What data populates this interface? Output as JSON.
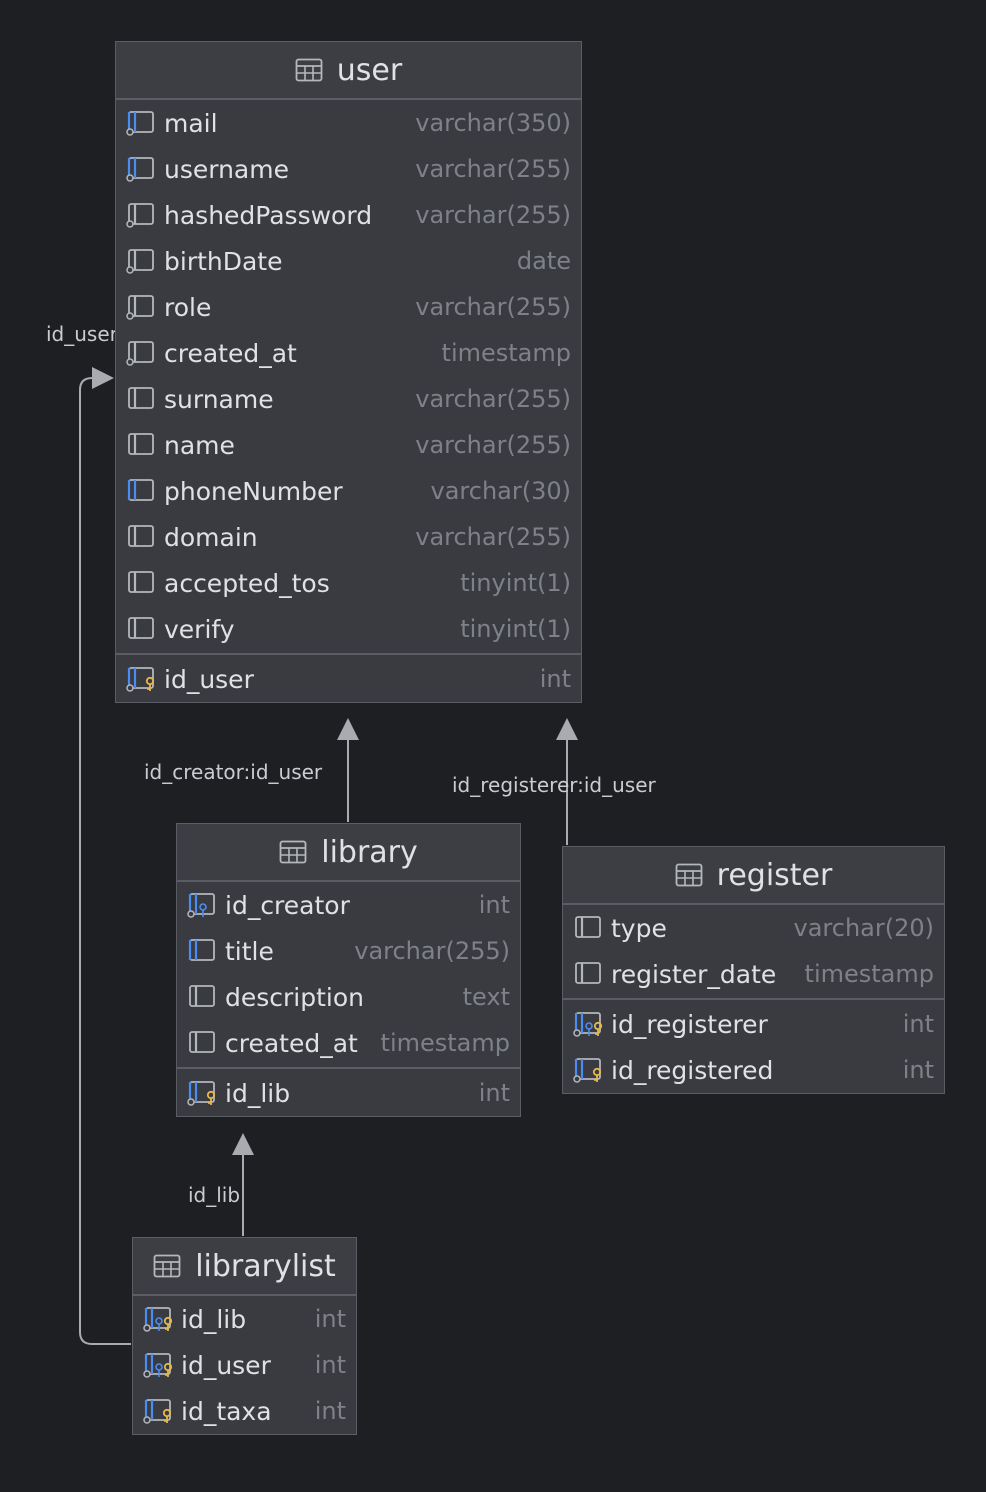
{
  "colors": {
    "background": "#1e1f22",
    "table_body": "#393b40",
    "table_header": "#3c3e43",
    "border": "#5a5d63",
    "text": "#dfe1e5",
    "type_text": "#7e8187",
    "edge": "#a9abb0",
    "fk_blue": "#4b8cf0",
    "pk_gold": "#e8b84a"
  },
  "tables": {
    "user": {
      "title": "user",
      "columns": [
        {
          "name": "mail",
          "type": "varchar(350)",
          "icon": "column-indexed-nullable-icon"
        },
        {
          "name": "username",
          "type": "varchar(255)",
          "icon": "column-indexed-nullable-icon"
        },
        {
          "name": "hashedPassword",
          "type": "varchar(255)",
          "icon": "column-nullable-icon"
        },
        {
          "name": "birthDate",
          "type": "date",
          "icon": "column-nullable-icon"
        },
        {
          "name": "role",
          "type": "varchar(255)",
          "icon": "column-nullable-icon"
        },
        {
          "name": "created_at",
          "type": "timestamp",
          "icon": "column-nullable-icon"
        },
        {
          "name": "surname",
          "type": "varchar(255)",
          "icon": "column-icon"
        },
        {
          "name": "name",
          "type": "varchar(255)",
          "icon": "column-icon"
        },
        {
          "name": "phoneNumber",
          "type": "varchar(30)",
          "icon": "column-indexed-icon"
        },
        {
          "name": "domain",
          "type": "varchar(255)",
          "icon": "column-icon"
        },
        {
          "name": "accepted_tos",
          "type": "tinyint(1)",
          "icon": "column-icon"
        },
        {
          "name": "verify",
          "type": "tinyint(1)",
          "icon": "column-icon"
        }
      ],
      "keys": [
        {
          "name": "id_user",
          "type": "int",
          "icon": "primary-key-icon"
        }
      ]
    },
    "library": {
      "title": "library",
      "columns": [
        {
          "name": "id_creator",
          "type": "int",
          "icon": "foreign-key-icon"
        },
        {
          "name": "title",
          "type": "varchar(255)",
          "icon": "column-indexed-icon"
        },
        {
          "name": "description",
          "type": "text",
          "icon": "column-icon"
        },
        {
          "name": "created_at",
          "type": "timestamp",
          "icon": "column-icon"
        }
      ],
      "keys": [
        {
          "name": "id_lib",
          "type": "int",
          "icon": "primary-key-icon"
        }
      ]
    },
    "register": {
      "title": "register",
      "columns": [
        {
          "name": "type",
          "type": "varchar(20)",
          "icon": "column-icon"
        },
        {
          "name": "register_date",
          "type": "timestamp",
          "icon": "column-icon"
        }
      ],
      "keys": [
        {
          "name": "id_registerer",
          "type": "int",
          "icon": "primary-foreign-key-icon"
        },
        {
          "name": "id_registered",
          "type": "int",
          "icon": "primary-key-icon"
        }
      ]
    },
    "librarylist": {
      "title": "librarylist",
      "columns": [],
      "keys": [
        {
          "name": "id_lib",
          "type": "int",
          "icon": "primary-foreign-key-icon"
        },
        {
          "name": "id_user",
          "type": "int",
          "icon": "primary-foreign-key-icon"
        },
        {
          "name": "id_taxa",
          "type": "int",
          "icon": "primary-key-icon"
        }
      ]
    }
  },
  "edges": {
    "library_user": "id_creator:id_user",
    "register_user": "id_registerer:id_user",
    "librarylist_library": "id_lib",
    "librarylist_user": "id_user"
  }
}
